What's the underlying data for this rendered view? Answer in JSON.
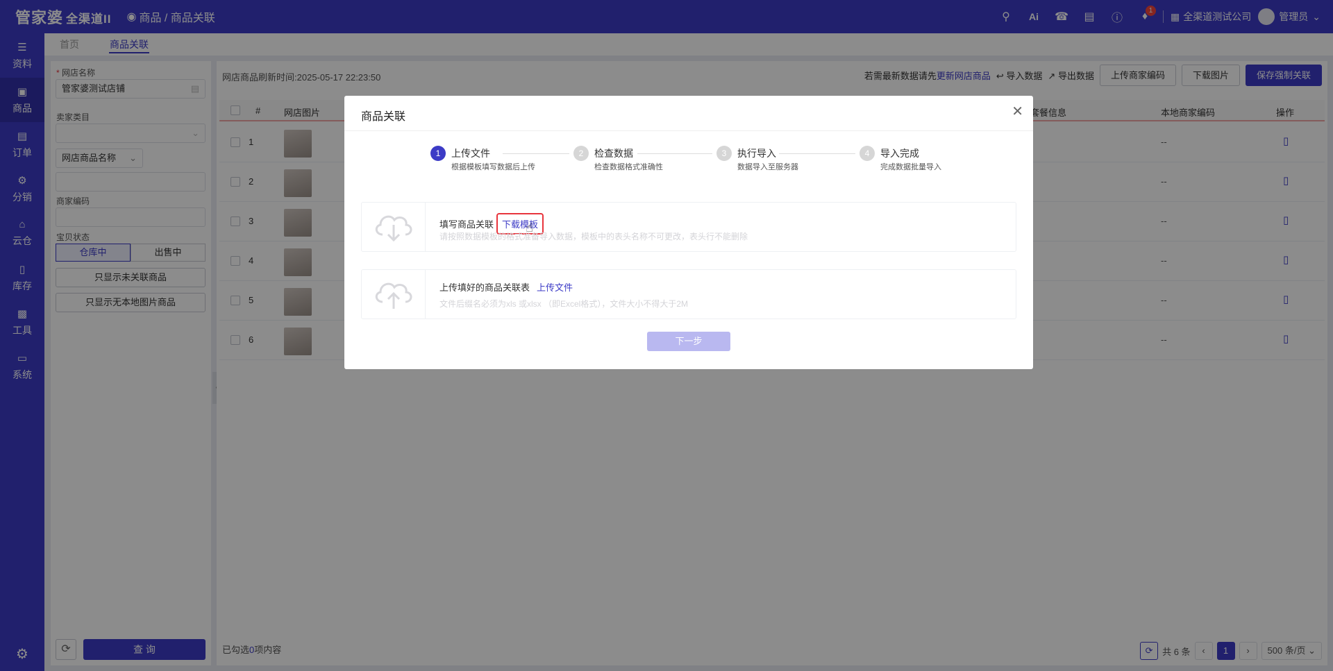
{
  "app": {
    "logo": "管家婆",
    "logo_sub": "全渠道II",
    "breadcrumb": "商品 / 商品关联",
    "badge_count": "1",
    "company": "全渠道测试公司",
    "user": "管理员",
    "ai_label": "Ai"
  },
  "sidebar": {
    "items": [
      {
        "label": "资料",
        "icon": "layers-icon"
      },
      {
        "label": "商品",
        "icon": "box-icon"
      },
      {
        "label": "订单",
        "icon": "document-icon"
      },
      {
        "label": "分销",
        "icon": "network-icon"
      },
      {
        "label": "云仓",
        "icon": "cloud-house-icon"
      },
      {
        "label": "库存",
        "icon": "clipboard-icon"
      },
      {
        "label": "工具",
        "icon": "toolbox-icon"
      },
      {
        "label": "系统",
        "icon": "monitor-icon"
      }
    ],
    "active": "商品"
  },
  "tabs": [
    "首页",
    "商品关联"
  ],
  "filters": {
    "shop_label": "网店名称",
    "shop_value": "管家婆测试店铺",
    "category_label": "卖家类目",
    "category_value": "",
    "name_select": "网店商品名称",
    "name_value": "",
    "code_label": "商家编码",
    "code_value": "",
    "status_label": "宝贝状态",
    "status_in": "仓库中",
    "status_sale": "出售中",
    "btn_unlinked": "只显示未关联商品",
    "btn_noimg": "只显示无本地图片商品",
    "query": "查 询"
  },
  "toolbar": {
    "refresh_time_label": "网店商品刷新时间:",
    "refresh_time": "2025-05-17 22:23:50",
    "latest_hint": "若需最新数据请先",
    "update_link": "更新网店商品",
    "import": "导入数据",
    "export": "导出数据",
    "upload_code": "上传商家编码",
    "download_img": "下载图片",
    "save_force": "保存强制关联"
  },
  "table": {
    "headers": [
      "#",
      "网店图片",
      "套餐信息",
      "本地商家编码",
      "操作"
    ],
    "rows": [
      {
        "no": "1",
        "code": "--"
      },
      {
        "no": "2",
        "code": "--"
      },
      {
        "no": "3",
        "code": "--"
      },
      {
        "no": "4",
        "code": "--"
      },
      {
        "no": "5",
        "code": "--"
      },
      {
        "no": "6",
        "code": "--"
      }
    ]
  },
  "footer": {
    "selected_prefix": "已勾选",
    "selected_count": "0",
    "selected_suffix": "项内容",
    "total": "共 6 条",
    "page": "1",
    "page_size": "500 条/页"
  },
  "modal": {
    "title": "商品关联",
    "steps": [
      {
        "num": "1",
        "title": "上传文件",
        "desc": "根据模板填写数据后上传"
      },
      {
        "num": "2",
        "title": "检查数据",
        "desc": "检查数据格式准确性"
      },
      {
        "num": "3",
        "title": "执行导入",
        "desc": "数据导入至服务器"
      },
      {
        "num": "4",
        "title": "导入完成",
        "desc": "完成数据批量导入"
      }
    ],
    "card1_title": "填写商品关联",
    "card1_link": "下载模板",
    "card1_desc": "请按照数据模板的格式准备导入数据，模板中的表头名称不可更改，表头行不能删除",
    "card2_title": "上传填好的商品关联表",
    "card2_link": "上传文件",
    "card2_desc": "文件后缀名必须为xls 或xlsx （即Excel格式），文件大小不得大于2M",
    "next": "下一步"
  }
}
